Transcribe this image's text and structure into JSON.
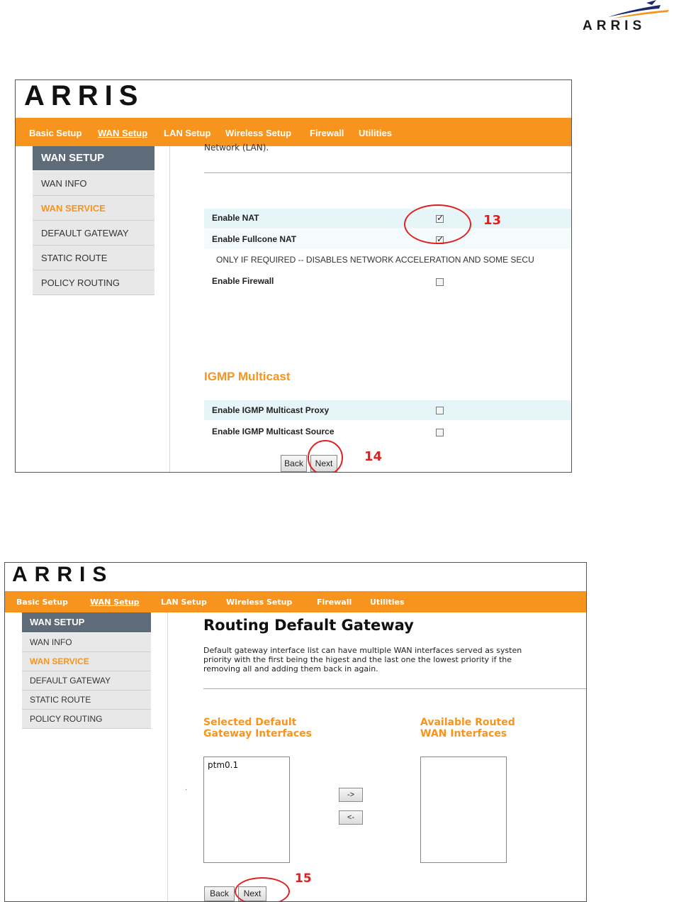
{
  "brand": {
    "logo_text": "ARRIS"
  },
  "shot1": {
    "logo_text": "ARRIS",
    "nav": [
      "Basic Setup",
      "WAN Setup",
      "LAN Setup",
      "Wireless Setup",
      "Firewall",
      "Utilities"
    ],
    "sidebar": {
      "header": "WAN SETUP",
      "items": [
        "WAN INFO",
        "WAN SERVICE",
        "DEFAULT GATEWAY",
        "STATIC ROUTE",
        "POLICY ROUTING"
      ]
    },
    "intro_fragment": "Network (LAN).",
    "options": [
      {
        "label": "Enable NAT",
        "checked": true
      },
      {
        "label": "Enable Fullcone NAT",
        "checked": true
      }
    ],
    "warning": "ONLY IF REQUIRED -- DISABLES NETWORK ACCELERATION AND SOME SECU",
    "firewall": {
      "label": "Enable Firewall",
      "checked": false
    },
    "igmp_heading": "IGMP Multicast",
    "igmp_options": [
      {
        "label": "Enable IGMP Multicast Proxy",
        "checked": false
      },
      {
        "label": "Enable IGMP Multicast Source",
        "checked": false
      }
    ],
    "back_label": "Back",
    "next_label": "Next",
    "annotation_nat": "13",
    "annotation_next": "14"
  },
  "shot2": {
    "logo_text": "ARRIS",
    "nav": [
      "Basic Setup",
      "WAN Setup",
      "LAN Setup",
      "Wireless Setup",
      "Firewall",
      "Utilities"
    ],
    "sidebar": {
      "header": "WAN SETUP",
      "items": [
        "WAN INFO",
        "WAN SERVICE",
        "DEFAULT GATEWAY",
        "STATIC ROUTE",
        "POLICY ROUTING"
      ]
    },
    "title": "Routing Default Gateway",
    "description": [
      "Default gateway interface list can have multiple WAN interfaces served as systen",
      "priority with the first being the higest and the last one the lowest priority if the",
      "removing all and adding them back in again."
    ],
    "selected_heading": [
      "Selected Default",
      "Gateway Interfaces"
    ],
    "available_heading": [
      "Available Routed",
      "WAN Interfaces"
    ],
    "selected_items": [
      "ptm0.1"
    ],
    "available_items": [],
    "move_right_label": "->",
    "move_left_label": "<-",
    "stray_mark": "·",
    "back_label": "Back",
    "next_label": "Next",
    "annotation_next": "15"
  },
  "colors": {
    "accent": "#f7941d",
    "sidebar_header": "#5e6b78",
    "annotation": "#e02020",
    "row_shade": "#e6f6f8"
  }
}
